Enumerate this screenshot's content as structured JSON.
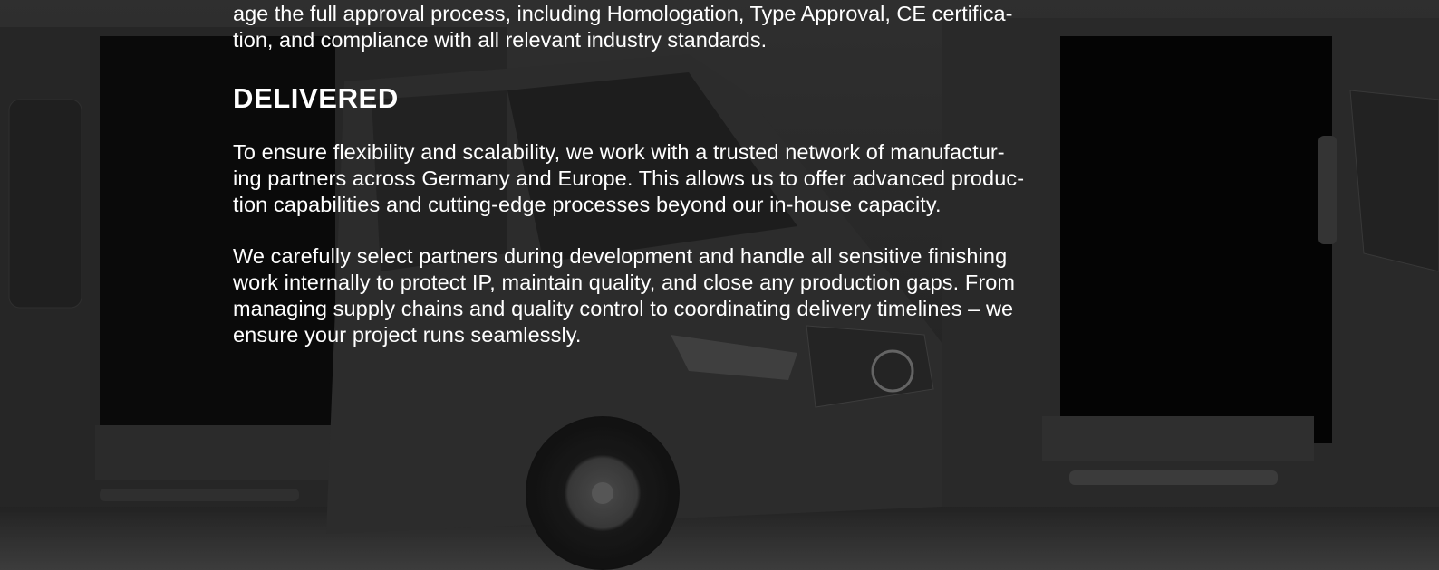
{
  "background": {
    "image": "two-vans-with-open-doors-photo",
    "tone": "grayscale"
  },
  "intro_lines": [
    "age the full approval process, including Homologation, Type Approval, CE certifica-",
    "tion, and compliance with all relevant industry standards."
  ],
  "section": {
    "heading": "DELIVERED",
    "paragraph1_lines": [
      "To ensure flexibility and scalability, we work with a trusted network of manufactur-",
      "ing partners across Germany and Europe. This allows us to offer advanced produc-",
      "tion capabilities and cutting-edge processes beyond our in-house capacity."
    ],
    "paragraph2_lines": [
      "We carefully select partners during development and handle all sensitive finishing",
      "work internally to protect IP, maintain quality, and close any production gaps. From",
      "managing supply chains and quality control to coordinating delivery timelines – we",
      "ensure your project runs seamlessly."
    ]
  },
  "colors": {
    "text": "#ffffff",
    "background": "#2a2a2a"
  }
}
